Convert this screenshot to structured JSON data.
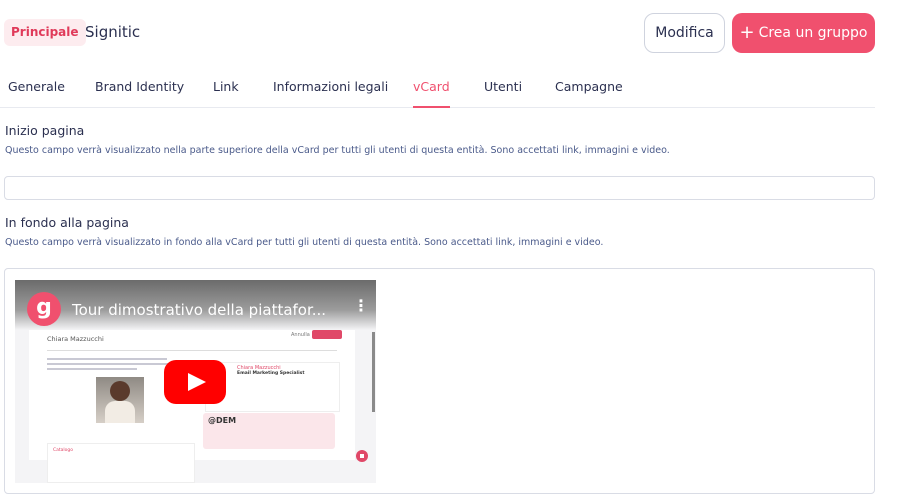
{
  "header": {
    "badge": "Principale",
    "entity_name": "Signitic",
    "edit_label": "Modifica",
    "create_label": "Crea un gruppo",
    "create_icon": "plus-icon"
  },
  "tabs": [
    {
      "label": "Generale",
      "active": false
    },
    {
      "label": "Brand Identity",
      "active": false
    },
    {
      "label": "Link",
      "active": false
    },
    {
      "label": "Informazioni legali",
      "active": false
    },
    {
      "label": "vCard",
      "active": true
    },
    {
      "label": "Utenti",
      "active": false
    },
    {
      "label": "Campagne",
      "active": false
    }
  ],
  "top_section": {
    "title": "Inizio pagina",
    "description": "Questo campo verrà visualizzato nella parte superiore della vCard per tutti gli utenti di questa entità. Sono accettati link, immagini e video.",
    "value": ""
  },
  "bottom_section": {
    "title": "In fondo alla pagina",
    "description": "Questo campo verrà visualizzato in fondo alla vCard per tutti gli utenti di questa entità. Sono accettati link, immagini e video."
  },
  "video": {
    "logo": "g",
    "title": "Tour dimostrativo della piattafor...",
    "menu_icon": "more-vertical-icon",
    "play_icon": "youtube-play-icon",
    "embedded_name": "Chiara Mazzucchi",
    "embedded_card_role": "Email Marketing Specialist",
    "embedded_brand": "@DEM"
  },
  "colors": {
    "accent": "#f0506e",
    "badge_bg": "#fdecef",
    "text": "#2b3050",
    "description": "#4a5a8a"
  }
}
